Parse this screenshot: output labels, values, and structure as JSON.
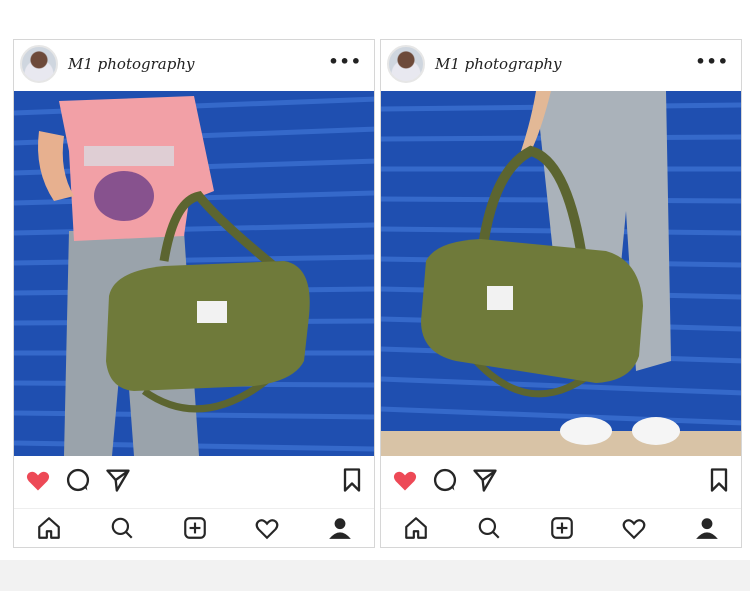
{
  "posts": [
    {
      "username": "M1 photography",
      "more": "•••",
      "liked": true
    },
    {
      "username": "M1 photography",
      "more": "•••",
      "liked": true
    }
  ],
  "icons": {
    "like": "heart-icon",
    "comment": "comment-icon",
    "share": "send-icon",
    "save": "bookmark-icon",
    "nav": [
      "home-icon",
      "search-icon",
      "add-post-icon",
      "activity-heart-icon",
      "profile-icon"
    ]
  },
  "colors": {
    "like_red": "#ed4956",
    "bag_green": "#6f7a3a",
    "wall_blue": "#1f4fb0"
  }
}
